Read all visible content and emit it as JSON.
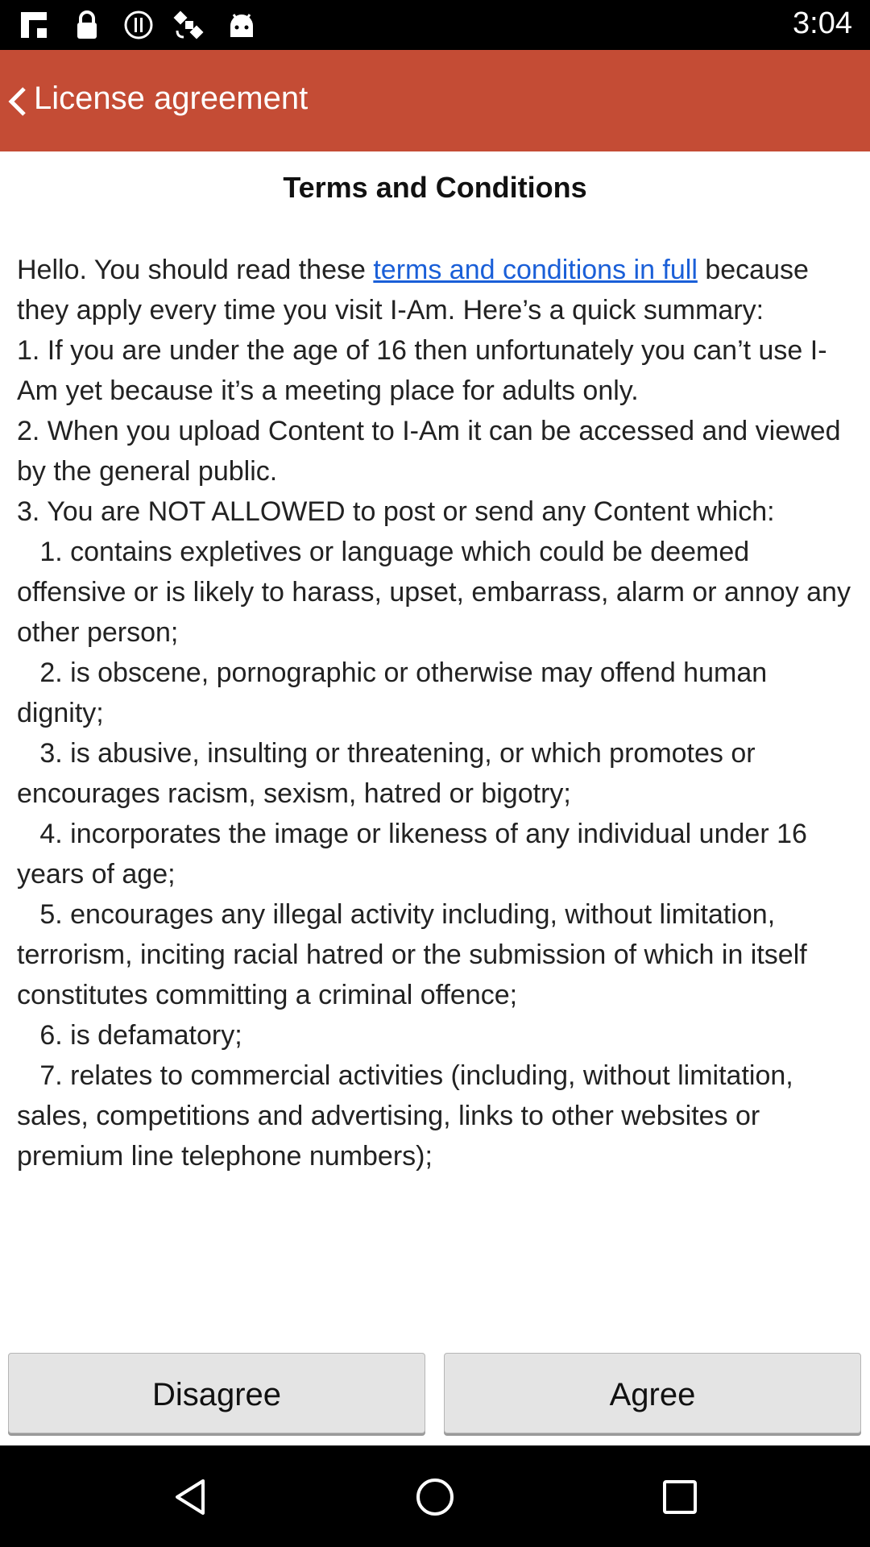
{
  "status_bar": {
    "time": "3:04",
    "icons": [
      "flipboard-icon",
      "lock-icon",
      "info-icon",
      "satellite-icon",
      "android-icon"
    ]
  },
  "header": {
    "back_icon": "chevron-left-icon",
    "title": "License agreement",
    "bg_color": "#c44c35"
  },
  "terms": {
    "title": "Terms and Conditions",
    "intro_before_link": "Hello. You should read these ",
    "link_text": "terms and conditions in full",
    "intro_after_link": " because they apply every time you visit I-Am. Here’s a quick summary:",
    "points": [
      "1. If you are under the age of 16 then unfortunately you can’t use I-Am yet because it’s a meeting place for adults only.",
      "2. When you upload Content to I-Am it can be accessed and viewed by the general public.",
      "3. You are NOT ALLOWED to post or send any Content which:"
    ],
    "subpoints": [
      "   1. contains expletives or language which could be deemed offensive or is likely to harass, upset, embarrass, alarm or annoy any other person;",
      "   2. is obscene, pornographic or otherwise may offend human dignity;",
      "   3. is abusive, insulting or threatening, or which promotes or encourages racism, sexism, hatred or bigotry;",
      "   4. incorporates the image or likeness of any individual under 16 years of age;",
      "   5. encourages any illegal activity including, without limitation, terrorism, inciting racial hatred or the submission of which in itself constitutes committing a criminal offence;",
      "   6. is defamatory;",
      "   7. relates to commercial activities (including, without limitation, sales, competitions and advertising, links to other websites or premium line telephone numbers);"
    ],
    "link_color": "#1a5fd8"
  },
  "buttons": {
    "disagree": "Disagree",
    "agree": "Agree"
  },
  "nav_bar": {
    "icons": [
      "back-triangle-icon",
      "home-circle-icon",
      "recents-square-icon"
    ]
  }
}
